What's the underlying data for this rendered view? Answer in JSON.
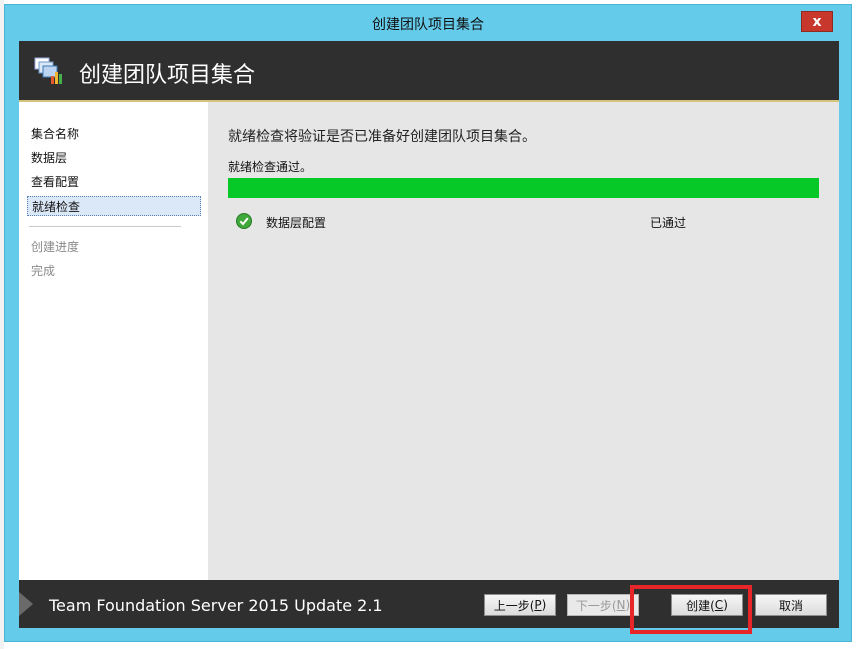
{
  "window": {
    "title": "创建团队项目集合",
    "close_label": "x"
  },
  "header": {
    "title": "创建团队项目集合",
    "icon": "team-collection-icon"
  },
  "sidebar": {
    "items": [
      {
        "label": "集合名称",
        "state": "normal"
      },
      {
        "label": "数据层",
        "state": "normal"
      },
      {
        "label": "查看配置",
        "state": "normal"
      },
      {
        "label": "就绪检查",
        "state": "active"
      }
    ],
    "later_items": [
      {
        "label": "创建进度",
        "state": "disabled"
      },
      {
        "label": "完成",
        "state": "disabled"
      }
    ]
  },
  "main": {
    "heading": "就绪检查将验证是否已准备好创建团队项目集合。",
    "status": "就绪检查通过。",
    "progress_percent": 100,
    "progress_color": "#06c827",
    "checks": [
      {
        "name": "数据层配置",
        "result": "已通过",
        "icon": "check-passed-icon"
      }
    ]
  },
  "footer": {
    "product": "Team Foundation Server 2015 Update 2.1",
    "buttons": {
      "prev": {
        "text": "上一步(",
        "key": "P",
        "end": ")"
      },
      "next": {
        "text": "下一步(",
        "key": "N",
        "end": ")"
      },
      "create": {
        "text": "创建(",
        "key": "C",
        "end": ")"
      },
      "cancel": {
        "text": "取消"
      }
    }
  },
  "colors": {
    "window_frame": "#65cbea",
    "header_bg": "#2f2f2f",
    "highlight": "#e8262a"
  }
}
